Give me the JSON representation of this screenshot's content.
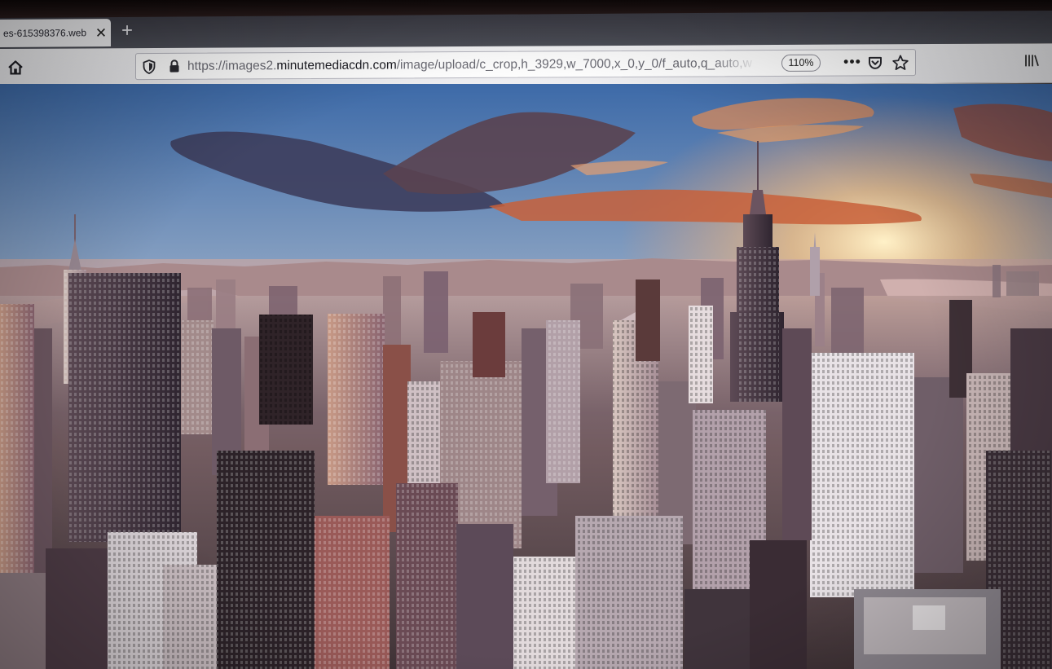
{
  "tab": {
    "title": "es-615398376.web",
    "close_glyph": "✕"
  },
  "newtab": {
    "glyph": "+"
  },
  "toolbar": {
    "home_icon": "home-icon",
    "url_prefix": "https://images2.",
    "url_host": "minutemediacdn.com",
    "url_path": "/image/upload/c_crop,h_3929,w_7000,x_0,y_0/f_auto,q_auto,w",
    "zoom": "110%",
    "more_glyph": "•••",
    "pocket_icon": "pocket-icon",
    "bookmark_icon": "star-icon",
    "library_glyph": "lll\\"
  },
  "colors": {
    "tabstrip": "#46464f",
    "toolbar": "#f0f0f3",
    "sky_top": "#3f6fb0",
    "sky_horizon": "#f2a060",
    "sun": "#ffe6a8"
  }
}
